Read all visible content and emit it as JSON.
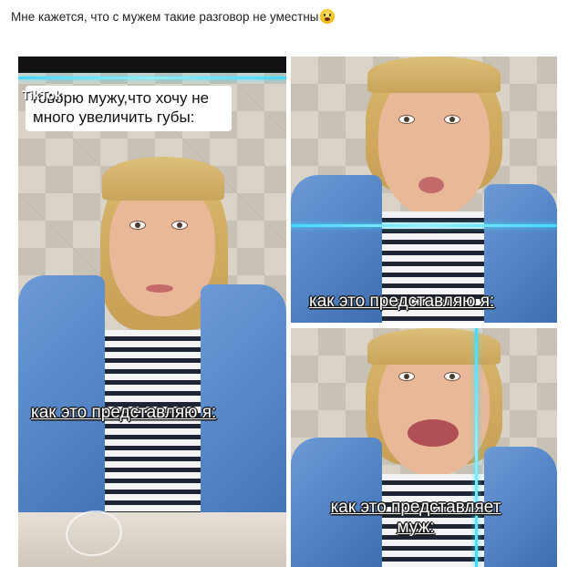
{
  "post": {
    "text": "Мне кажется, что с мужем такие разговор не уместны",
    "emoji": "scream-emoji"
  },
  "left_panel": {
    "app_label": "TikTok",
    "speech": "говорю мужу,что хочу не много увеличить губы:",
    "caption": "как это представляю я:",
    "watermark_icon": "handwritten-logo-stamp"
  },
  "top_right_panel": {
    "caption": "как это представляю я:"
  },
  "bottom_right_panel": {
    "caption_line1": "как это представляет",
    "caption_line2": "муж:"
  },
  "colors": {
    "accent_line": "#46d8ff",
    "jacket": "#5b8cd0",
    "hair": "#d3b266"
  }
}
